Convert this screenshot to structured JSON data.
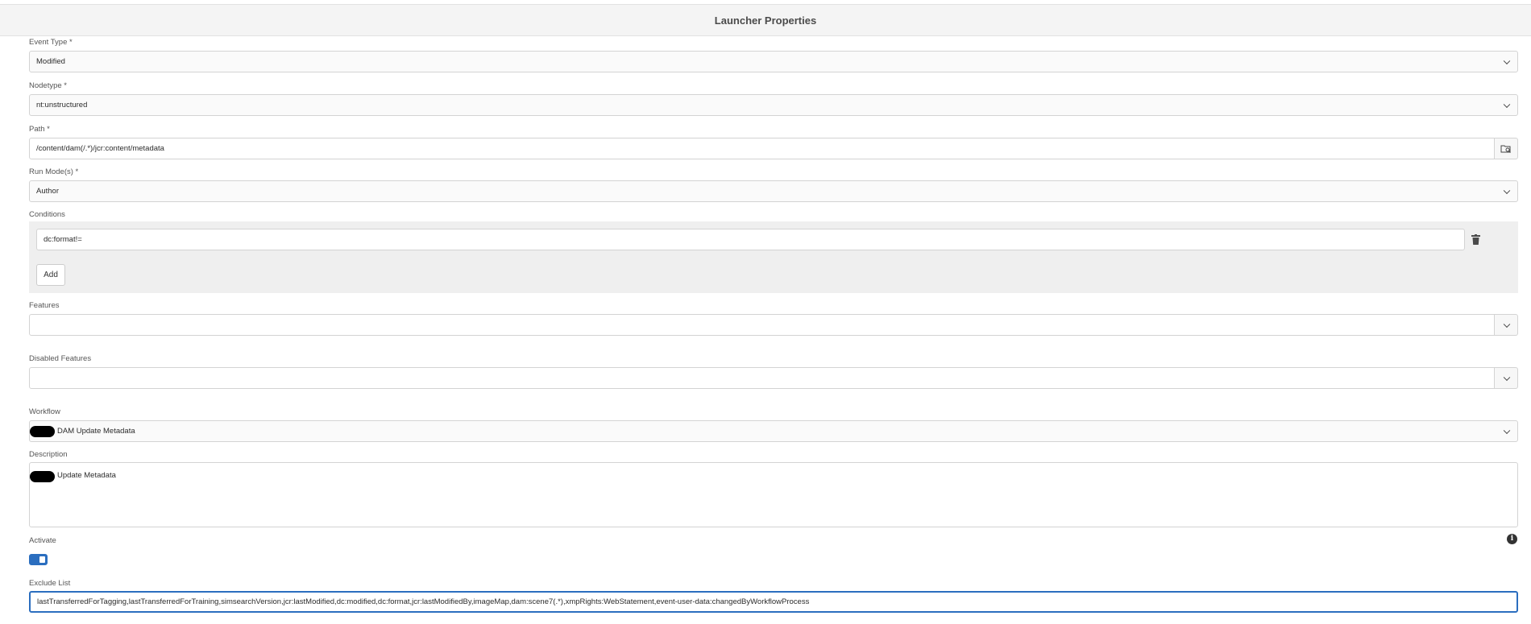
{
  "dialog": {
    "title": "Launcher Properties"
  },
  "fields": {
    "event_type": {
      "label": "Event Type *",
      "value": "Modified"
    },
    "nodetype": {
      "label": "Nodetype *",
      "value": "nt:unstructured"
    },
    "path": {
      "label": "Path *",
      "value": "/content/dam(/.*)/jcr:content/metadata",
      "browse_icon": "folder-search-icon"
    },
    "run_modes": {
      "label": "Run Mode(s) *",
      "value": "Author"
    },
    "conditions": {
      "label": "Conditions",
      "items": [
        "dc:format!="
      ],
      "delete_icon": "trash-icon",
      "add_label": "Add"
    },
    "features": {
      "label": "Features",
      "value": ""
    },
    "disabled_features": {
      "label": "Disabled Features",
      "value": ""
    },
    "workflow": {
      "label": "Workflow",
      "value": "DAM Update Metadata"
    },
    "description": {
      "label": "Description",
      "value": "Update Metadata"
    },
    "activate": {
      "label": "Activate",
      "checked": true,
      "info_icon": "info-icon"
    },
    "exclude_list": {
      "label": "Exclude List",
      "value": "lastTransferredForTagging,lastTransferredForTraining,simsearchVersion,jcr:lastModified,dc:modified,dc:format,jcr:lastModifiedBy,imageMap,dam:scene7(.*),xmpRights:WebStatement,event-user-data:changedByWorkflowProcess"
    }
  },
  "colors": {
    "accent": "#2b6ebf",
    "header_bg": "#f4f4f4",
    "panel_bg": "#efefef"
  }
}
